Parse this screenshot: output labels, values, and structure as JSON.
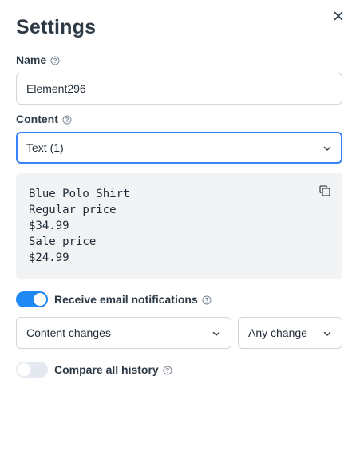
{
  "panel": {
    "title": "Settings",
    "close_icon": "close-icon"
  },
  "name_field": {
    "label": "Name",
    "value": "Element296",
    "help_icon": "question-circle-icon"
  },
  "content_field": {
    "label": "Content",
    "selected": "Text (1)",
    "help_icon": "question-circle-icon"
  },
  "preview": {
    "lines": [
      "Blue Polo Shirt",
      "Regular price",
      "$34.99",
      "Sale price",
      "$24.99"
    ],
    "copy_icon": "copy-icon"
  },
  "email_notifications": {
    "label": "Receive email notifications",
    "enabled": true,
    "trigger_select": "Content changes",
    "change_select": "Any change"
  },
  "compare_history": {
    "label": "Compare all history",
    "enabled": false
  },
  "colors": {
    "accent": "#1e88f5",
    "focus_border": "#3b82f6",
    "preview_bg": "#f2f3f5"
  }
}
